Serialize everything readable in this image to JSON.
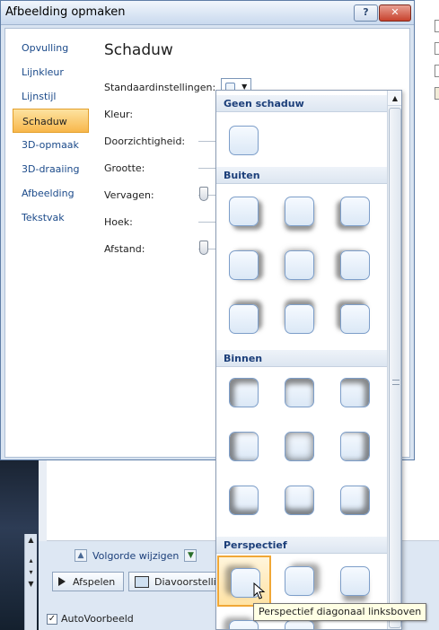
{
  "dialog": {
    "title": "Afbeelding opmaken",
    "help_label": "?",
    "close_label": "✕"
  },
  "nav": {
    "items": [
      {
        "label": "Opvulling"
      },
      {
        "label": "Lijnkleur"
      },
      {
        "label": "Lijnstijl"
      },
      {
        "label": "Schaduw"
      },
      {
        "label": "3D-opmaak"
      },
      {
        "label": "3D-draaiing"
      },
      {
        "label": "Afbeelding"
      },
      {
        "label": "Tekstvak"
      }
    ],
    "selected": "Schaduw"
  },
  "pane": {
    "heading": "Schaduw",
    "preset_label": "Standaardinstellingen:",
    "color_label": "Kleur:",
    "transparency_label": "Doorzichtigheid:",
    "size_label": "Grootte:",
    "blur_label": "Vervagen:",
    "angle_label": "Hoek:",
    "distance_label": "Afstand:"
  },
  "gallery": {
    "sections": [
      {
        "label": "Geen schaduw"
      },
      {
        "label": "Buiten"
      },
      {
        "label": "Binnen"
      },
      {
        "label": "Perspectief"
      }
    ],
    "hover_tooltip": "Perspectief diagonaal linksboven",
    "scroll_up_icon": "up-arrow-icon"
  },
  "background": {
    "reorder_label": "Volgorde wijzigen",
    "play_label": "Afspelen",
    "slideshow_label": "Diavoorstellin",
    "autopreview_label": "AutoVoorbeeld"
  },
  "colors": {
    "accent": "#f8b74c",
    "link": "#1b4a8a",
    "close": "#c8422d"
  }
}
